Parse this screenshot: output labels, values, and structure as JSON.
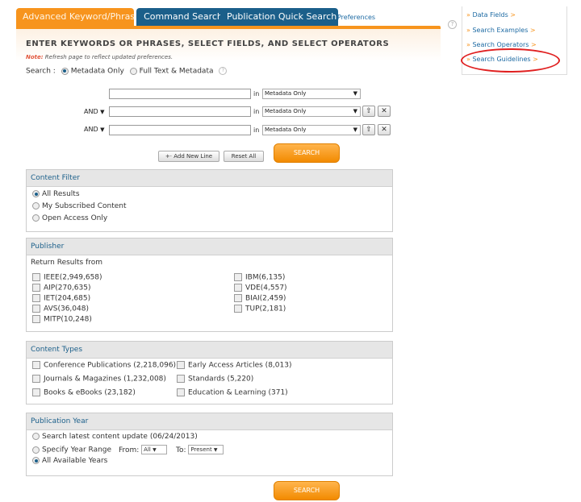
{
  "tabs": [
    "Advanced Keyword/Phrases",
    "Command Search",
    "Publication Quick Search"
  ],
  "preferences": "Preferences",
  "heading": "ENTER KEYWORDS OR PHRASES, SELECT FIELDS, AND SELECT OPERATORS",
  "note_label": "Note:",
  "note_text": " Refresh page to reflect updated preferences.",
  "search_mode": {
    "label": "Search :",
    "options": [
      "Metadata Only",
      "Full Text & Metadata"
    ],
    "selected": "Metadata Only"
  },
  "query_rows": [
    {
      "operator": "",
      "value": "",
      "in_label": "in",
      "field": "Metadata Only"
    },
    {
      "operator": "AND",
      "value": "",
      "in_label": "in",
      "field": "Metadata Only"
    },
    {
      "operator": "AND",
      "value": "",
      "in_label": "in",
      "field": "Metadata Only"
    }
  ],
  "buttons": {
    "add_line": "Add New Line",
    "reset": "Reset All",
    "search": "SEARCH"
  },
  "content_filter": {
    "title": "Content Filter",
    "options": [
      "All Results",
      "My Subscribed Content",
      "Open Access Only"
    ],
    "selected": "All Results"
  },
  "publisher": {
    "title": "Publisher",
    "subtitle": "Return Results from",
    "left": [
      "IEEE(2,949,658)",
      "AIP(270,635)",
      "IET(204,685)",
      "AVS(36,048)",
      "MITP(10,248)"
    ],
    "right": [
      "IBM(6,135)",
      "VDE(4,557)",
      "BIAI(2,459)",
      "TUP(2,181)"
    ]
  },
  "content_types": {
    "title": "Content Types",
    "left": [
      "Conference Publications (2,218,096)",
      "Journals & Magazines (1,232,008)",
      "Books & eBooks (23,182)"
    ],
    "right": [
      "Early Access Articles (8,013)",
      "Standards (5,220)",
      "Education & Learning (371)"
    ]
  },
  "publication_year": {
    "title": "Publication Year",
    "opt1": "Search latest content update (06/24/2013)",
    "opt2": "Specify Year Range",
    "from_label": "From:",
    "from_value": "All",
    "to_label": "To:",
    "to_value": "Present",
    "opt3": "All Available Years",
    "selected": "All Available Years"
  },
  "sidebar": {
    "arrow": "»",
    "tail": ">",
    "links": [
      "Data Fields",
      "Search Examples",
      "Search Operators",
      "Search Guidelines"
    ]
  },
  "colors": {
    "accent": "#f7941d",
    "tab_blue": "#1b5f8a",
    "link": "#1d6aa3",
    "highlight": "#e02020"
  }
}
